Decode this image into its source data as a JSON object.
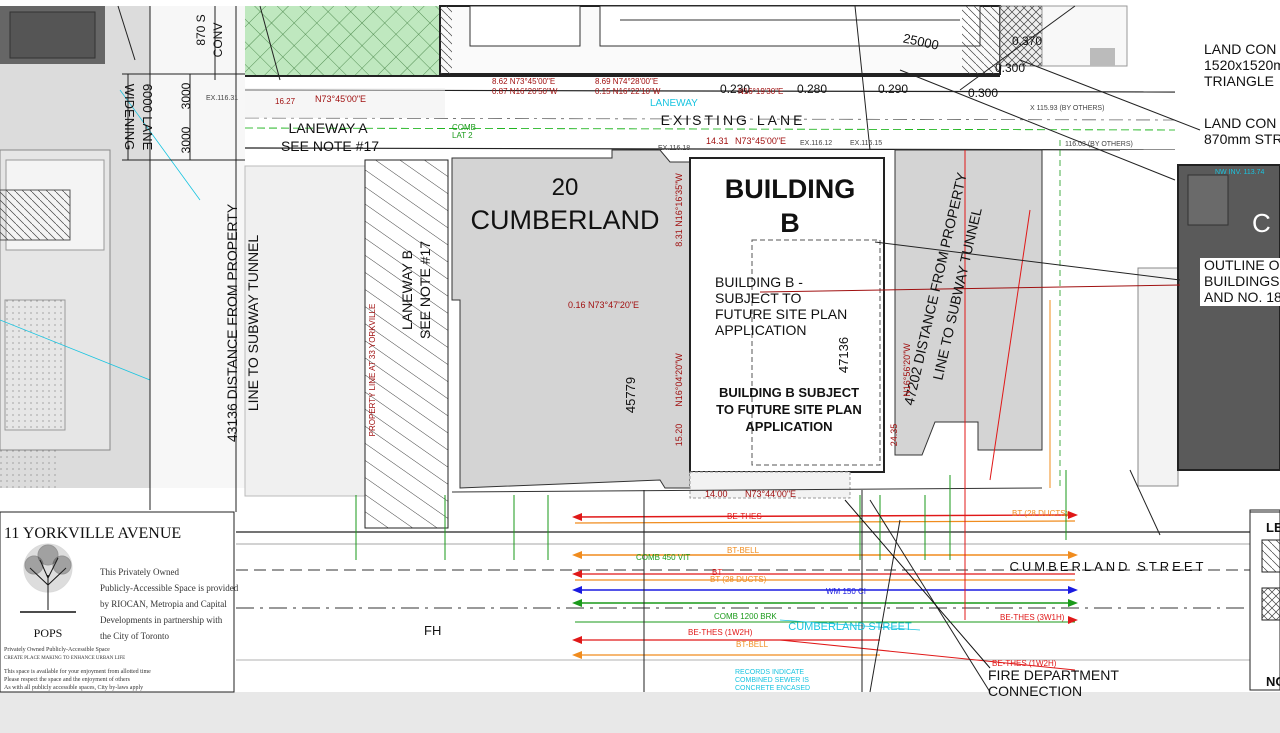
{
  "labels": {
    "title_20": "20",
    "title_cumberland": "CUMBERLAND",
    "building_b_1": "BUILDING",
    "building_b_2": "B",
    "existing_lane": "EXISTING  LANE",
    "cumberland_street": "CUMBERLAND  STREET",
    "cumberland_street_cyan": "CUMBERLAND STREET",
    "laneway_a_1": "LANEWAY A",
    "laneway_a_2": "SEE NOTE #17",
    "laneway_b_1": "LANEWAY B",
    "laneway_b_2": "SEE NOTE #17",
    "lane_widening_1": "6000 LANE",
    "lane_widening_2": "WIDENING",
    "dist_43136_1": "43136 DISTANCE FROM PROPERTY",
    "dist_43136_2": "LINE TO SUBWAY TUNNEL",
    "dist_47202_1": "47202 DISTANCE FROM PROPERTY",
    "dist_47202_2": "LINE TO SUBWAY TUNNEL",
    "bldgb_note_1": "BUILDING B -",
    "bldgb_note_2": "SUBJECT TO",
    "bldgb_note_3": "FUTURE SITE PLAN",
    "bldgb_note_4": "APPLICATION",
    "bldgb_bold_1": "BUILDING B SUBJECT",
    "bldgb_bold_2": "TO FUTURE SITE PLAN",
    "bldgb_bold_3": "APPLICATION",
    "dim_45779": "45779",
    "dim_47136": "47136",
    "dim_3000a": "3000",
    "dim_3000b": "3000",
    "dim_25000": "25000",
    "dim_870": "870 S",
    "dim_conv": "CONV",
    "dim_0370": "0.370",
    "dim_0300a": "0.300",
    "dim_0300b": "0.300",
    "dim_0280": "0.280",
    "dim_0290": "0.290",
    "dim_0230": "0.230",
    "land_con_1": "LAND CON",
    "land_con_2": "1520x1520m",
    "land_con_3": "TRIANGLE",
    "land_con_4": "LAND CON",
    "land_con_5": "870mm STR",
    "outline_1": "OUTLINE O",
    "outline_2": "BUILDINGS",
    "outline_3": "AND NO. 18",
    "fire_dept_1": "FIRE DEPARTMENT",
    "fire_dept_2": "CONNECTION",
    "fh": "FH",
    "laneway_cyan": "LANEWAY",
    "property_line_33": "PROPERTY LINE AT 33 YORKVILLE",
    "bearing_1": "N73°45'00\"E",
    "bearing_2": "N73°45'00\"E",
    "bearing_3": "0.16 N73°47'20\"E",
    "bearing_4": "8.31 N16°16'35\"W",
    "bearing_5": "N16°04'20\"W",
    "bearing_6": "N73°44'00\"E",
    "bearing_7": "N16°56'20\"W",
    "bearing_top_1": "8.62  N73°45'00\"E",
    "bearing_top_2": "8.69 N74°28'00\"E",
    "bearing_top_3": "0.87 N16°20'50\"W",
    "bearing_top_4": "0.15 N16°22'10\"W",
    "bearing_top_5": "N16°19'30\"E",
    "num_1431": "14.31",
    "num_1520": "15.20",
    "num_2435": "24.35",
    "num_1400": "14.00",
    "num_1627": "16.27",
    "comb_450": "COMB 450 VIT",
    "comb_1200": "COMB 1200 BRK",
    "wm_150": "WM 150 CI",
    "bt_bell_1": "BT-BELL",
    "bt_bell_2": "BT-BELL",
    "bt_28a": "BT (28 DUCTS)",
    "bt_28b": "BT (28 DUCTS)",
    "bt": "BT",
    "be_thes_1": "BE-THES",
    "be_thes_2": "BE-THES (1W2H)",
    "be_thes_3": "BE-THES (3W1H)",
    "be_thes_4": "BE-THES (1W2H)",
    "records_1": "RECORDS INDICATE",
    "records_2": "COMBINED SEWER IS",
    "records_3": "CONCRETE ENCASED",
    "comb_top": "COMB",
    "lat_2": "LAT 2",
    "ex_116_31": "EX.116.31",
    "ex_116_18": "EX.116.18",
    "ex_116_12": "EX.116.12",
    "ex_116_15": "EX.116.15",
    "by_others_1": "X 115.93 (BY OTHERS)",
    "by_others_2": "116.03 (BY OTHERS)",
    "nw_inv": "NW INV. 113.74",
    "yorkville_title": "11 YORKVILLE AVENUE",
    "pops_body_1": "This Privately Owned",
    "pops_body_2": "Publicly-Accessible Space is provided",
    "pops_body_3": "by RIOCAN, Metropia and Capital",
    "pops_body_4": "Developments in partnership with",
    "pops_body_5": "the City of Toronto",
    "pops_word": "POPS",
    "pops_sub": "Privately Owned Publicly-Accessible Space",
    "pops_sub2": "CREATE PLACE MAKING TO ENHANCE URBAN LIFE",
    "pops_small_1": "This space is available for your enjoyment from allotted time",
    "pops_small_2": "Please respect the space and the enjoyment of others",
    "pops_small_3": "As with all publicly accessible spaces, City by-laws apply",
    "legend_le": "LE",
    "legend_no": "NO",
    "right_c": "C"
  },
  "colors": {
    "lane_bg": "#ffffff",
    "building_grey": "#d4d4d4",
    "dark_building": "#5a5a5a",
    "utility_red": "#e01818",
    "utility_orange": "#f08c1e",
    "utility_blue": "#1a1ae0",
    "utility_green": "#1a9a1a",
    "cyan": "#19c4e0",
    "green_hatch": "#bfe8bf",
    "bearing_red": "#a01010"
  }
}
